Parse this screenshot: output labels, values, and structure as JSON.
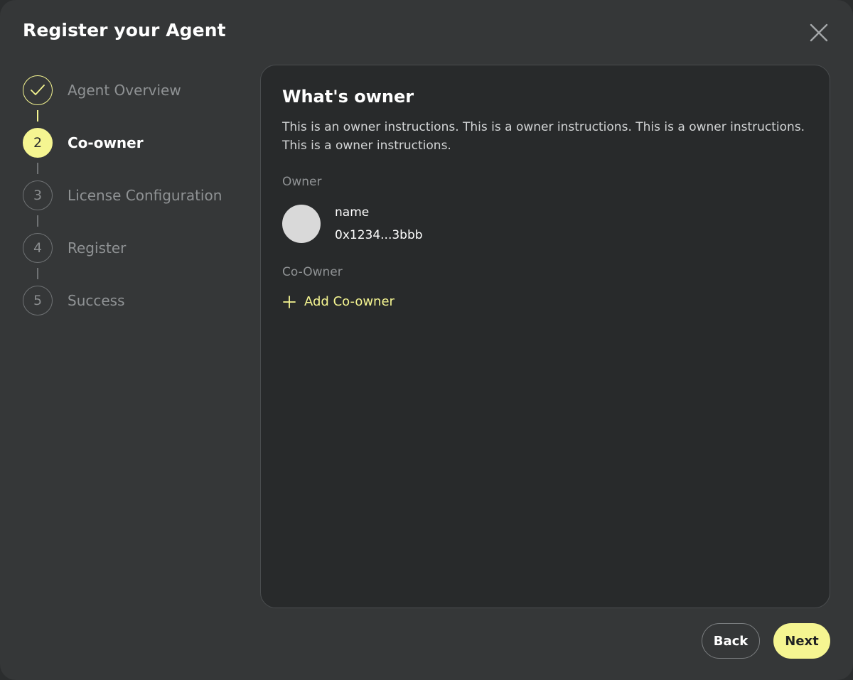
{
  "modal": {
    "title": "Register your Agent",
    "close_icon": "close-icon"
  },
  "stepper": {
    "steps": [
      {
        "number": "1",
        "label": "Agent Overview",
        "state": "completed",
        "icon": "checkmark-icon"
      },
      {
        "number": "2",
        "label": "Co-owner",
        "state": "active"
      },
      {
        "number": "3",
        "label": "License Configuration",
        "state": "pending"
      },
      {
        "number": "4",
        "label": "Register",
        "state": "pending"
      },
      {
        "number": "5",
        "label": "Success",
        "state": "pending"
      }
    ]
  },
  "content": {
    "title": "What's owner",
    "description": "This is an owner instructions. This is a owner instructions. This is a owner instructions. This is a owner instructions.",
    "owner_label": "Owner",
    "owner": {
      "name": "name",
      "address": "0x1234...3bbb"
    },
    "coowner_label": "Co-Owner",
    "add_coowner_label": "Add Co-owner",
    "add_icon": "plus-icon"
  },
  "footer": {
    "back_label": "Back",
    "next_label": "Next"
  },
  "colors": {
    "accent": "#f5f591",
    "modal_bg": "#353738",
    "card_bg": "#282a2b",
    "muted_text": "#8f9294"
  }
}
